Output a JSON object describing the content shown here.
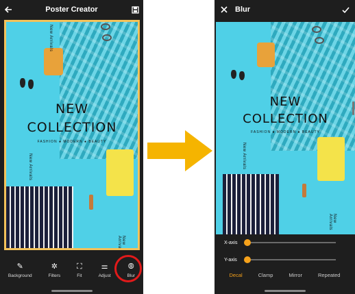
{
  "left_screen": {
    "title": "Poster Creator",
    "icons": {
      "back": "arrow-left-icon",
      "save": "save-icon"
    },
    "poster": {
      "headline_line1": "NEW",
      "headline_line2": "COLLECTION",
      "tagline": "FASHION ● MODERN ● BEAUTY",
      "side_text_top": "New Arrivals",
      "side_text_mid": "New Arrivals",
      "side_text_bottom": "New Arrivals"
    },
    "toolbar": [
      {
        "label": "Background",
        "icon": "eyedropper-icon",
        "glyph": "✎"
      },
      {
        "label": "Filters",
        "icon": "filters-icon",
        "glyph": "✲"
      },
      {
        "label": "Fit",
        "icon": "fit-icon",
        "glyph": "⛶"
      },
      {
        "label": "Adjust",
        "icon": "adjust-icon",
        "glyph": "⚌"
      },
      {
        "label": "Blur",
        "icon": "blur-icon",
        "glyph": "⦾"
      }
    ],
    "highlight_color": "#e21a1a"
  },
  "right_screen": {
    "title": "Blur",
    "icons": {
      "close": "close-icon",
      "confirm": "check-icon"
    },
    "poster": {
      "headline_line1": "NEW",
      "headline_line2": "COLLECTION",
      "tagline": "FASHION ● MODERN ● BEAUTY",
      "side_text_top": "New Arrivals",
      "side_text_bottom": "New Arrivals"
    },
    "sliders": [
      {
        "label": "X-axis",
        "value": 0
      },
      {
        "label": "Y-axis",
        "value": 0
      }
    ],
    "modes": [
      {
        "label": "Decal",
        "active": true
      },
      {
        "label": "Clamp",
        "active": false
      },
      {
        "label": "Mirror",
        "active": false
      },
      {
        "label": "Repeated",
        "active": false
      }
    ],
    "accent_color": "#f6a21b"
  },
  "arrow_color": "#f5b400"
}
